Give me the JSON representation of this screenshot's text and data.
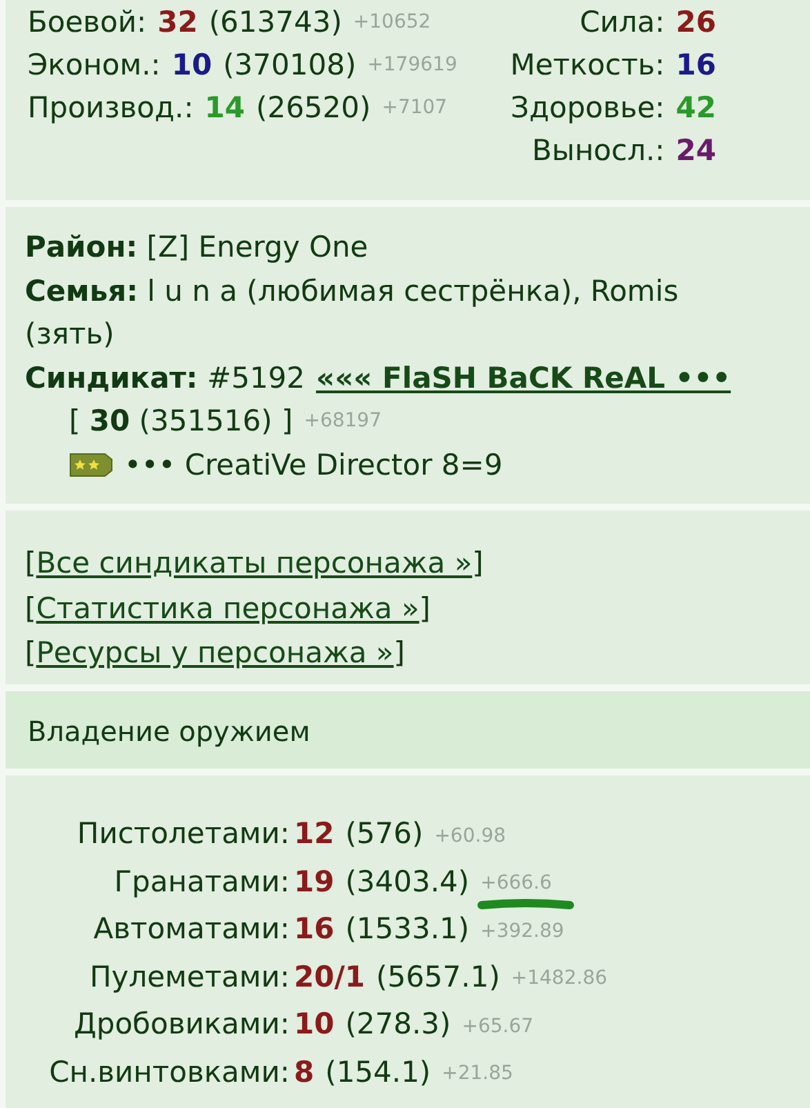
{
  "stats": {
    "left": [
      {
        "label": "Боевой:",
        "value": "32",
        "total": "(613743)",
        "delta": "+10652",
        "color": "#8b1a1a"
      },
      {
        "label": "Эконом.:",
        "value": "10",
        "total": "(370108)",
        "delta": "+179619",
        "color": "#1a1a8b"
      },
      {
        "label": "Производ.:",
        "value": "14",
        "total": "(26520)",
        "delta": "+7107",
        "color": "#2a9a2a"
      }
    ],
    "right": [
      {
        "label": "Сила:",
        "value": "26",
        "color": "#8b1a1a"
      },
      {
        "label": "Меткость:",
        "value": "16",
        "color": "#1a1a8b"
      },
      {
        "label": "Здоровье:",
        "value": "42",
        "color": "#2a9a2a"
      },
      {
        "label": "Выносл.:",
        "value": "24",
        "color": "#6a1a6a"
      }
    ]
  },
  "info": {
    "district": "**Район:** [Z] Energy One",
    "family": "**Семья:** l u n a (любимая сестрёнка), Romis (зять)",
    "syndicate": {
      "label": "**Синдикат:** #5192",
      "link": "««« FlaSH BaCK ReAL •••",
      "level": "[ **30** (351516) ]",
      "delta": "+68197",
      "rank": "••• CreatiVe Director 8=9"
    }
  },
  "links": [
    {
      "open": "[",
      "label": "Все синдикаты персонажа »",
      "close": "]"
    },
    {
      "open": "[",
      "label": "Статистика персонажа »",
      "close": "]"
    },
    {
      "open": "[",
      "label": "Ресурсы у персонажа »",
      "close": "]"
    }
  ],
  "weapons_header": "Владение оружием",
  "weapons": [
    {
      "label": "Пистолетами:",
      "value": "12",
      "total": "(576)",
      "delta": "+60.98",
      "underlined": false
    },
    {
      "label": "Гранатами:",
      "value": "19",
      "total": "(3403.4)",
      "delta": "+666.6",
      "underlined": true
    },
    {
      "label": "Автоматами:",
      "value": "16",
      "total": "(1533.1)",
      "delta": "+392.89",
      "underlined": false
    },
    {
      "label": "Пулеметами:",
      "value": "20/1",
      "total": "(5657.1)",
      "delta": "+1482.86",
      "underlined": false
    },
    {
      "label": "Дробовиками:",
      "value": "10",
      "total": "(278.3)",
      "delta": "+65.67",
      "underlined": false
    },
    {
      "label": "Сн.винтовками:",
      "value": "8",
      "total": "(154.1)",
      "delta": "+21.85",
      "underlined": false
    }
  ]
}
